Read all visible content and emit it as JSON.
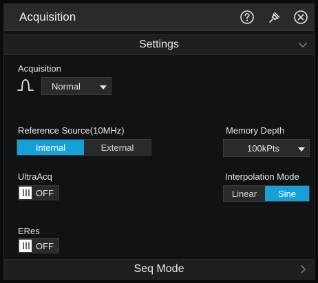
{
  "window": {
    "title": "Acquisition",
    "icons": [
      "help-circle-icon",
      "pin-icon",
      "close-circle-icon"
    ]
  },
  "sections": {
    "settings": {
      "label": "Settings"
    },
    "seq_mode": {
      "label": "Seq Mode"
    }
  },
  "acquisition": {
    "label": "Acquisition",
    "mode_icon": "pulse-icon",
    "value": "Normal"
  },
  "reference_source": {
    "label": "Reference Source(10MHz)",
    "options": [
      "Internal",
      "External"
    ],
    "selected": "Internal"
  },
  "memory_depth": {
    "label": "Memory Depth",
    "value": "100kPts"
  },
  "ultraacq": {
    "label": "UltraAcq",
    "state": "OFF"
  },
  "interpolation_mode": {
    "label": "Interpolation Mode",
    "options": [
      "Linear",
      "Sine"
    ],
    "selected": "Sine"
  },
  "eres": {
    "label": "ERes",
    "state": "OFF"
  },
  "colors": {
    "accent": "#16a0d8",
    "panel_bg": "#111214",
    "titlebar_bg": "#2a2a2a"
  }
}
